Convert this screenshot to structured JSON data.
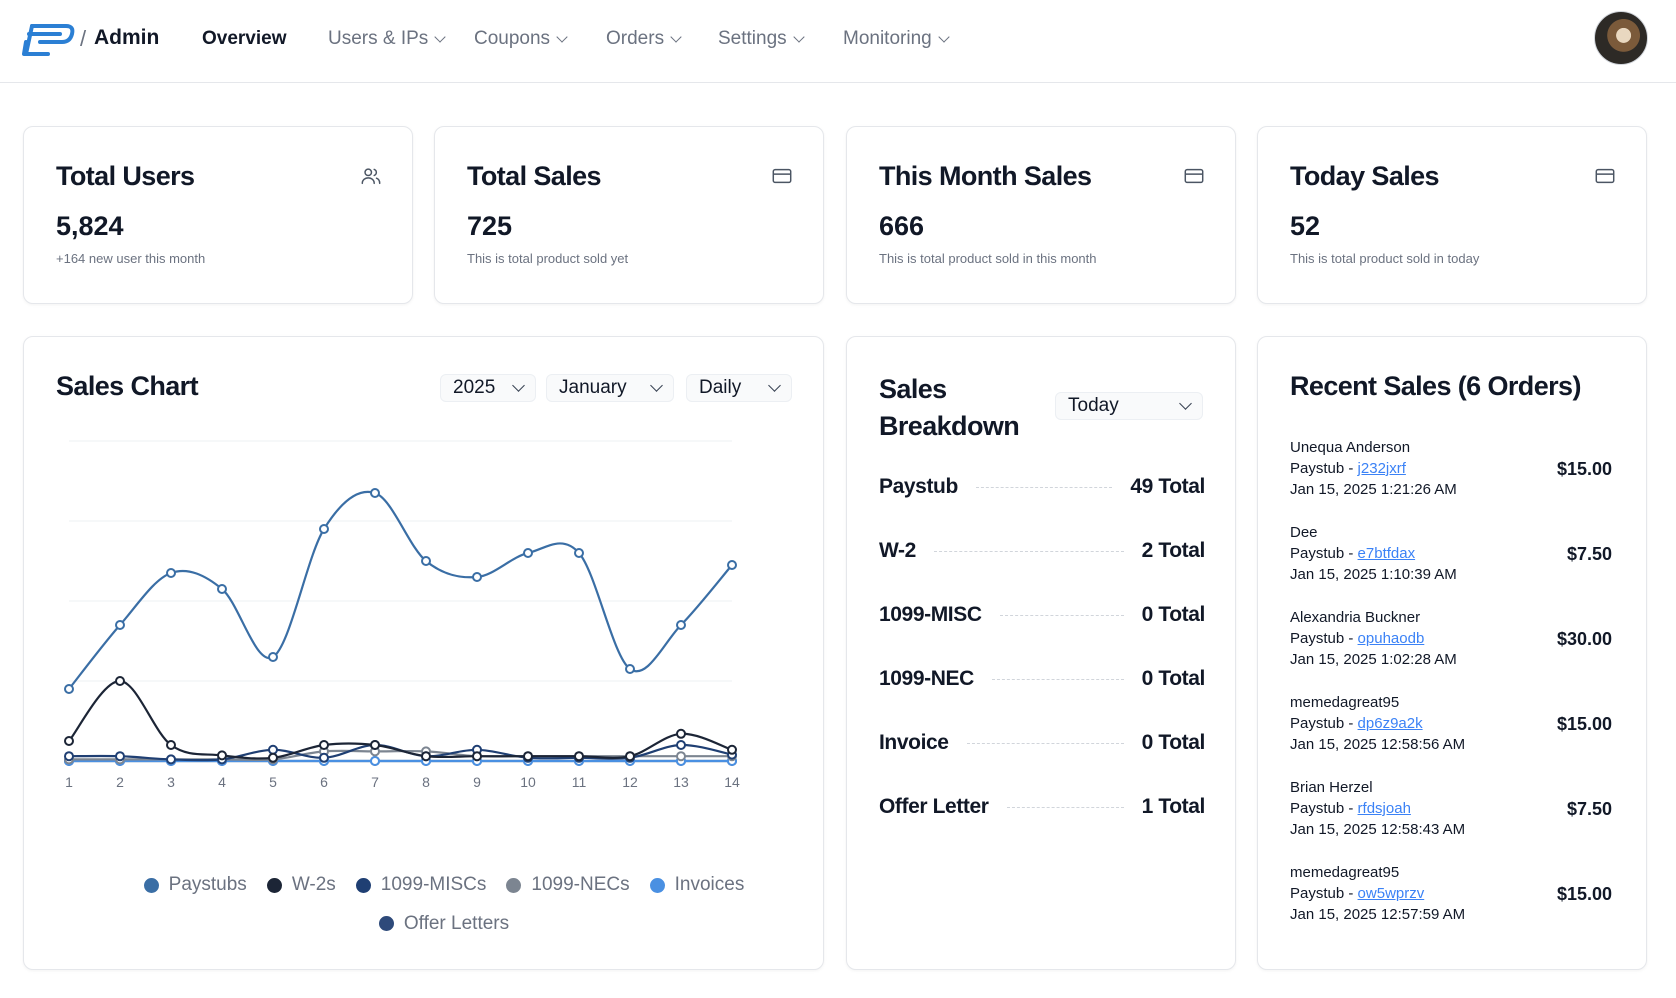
{
  "header": {
    "breadcrumb_sep": "/",
    "breadcrumb_admin": "Admin",
    "nav": [
      {
        "label": "Overview",
        "active": true
      },
      {
        "label": "Users & IPs",
        "active": false
      },
      {
        "label": "Coupons",
        "active": false
      },
      {
        "label": "Orders",
        "active": false
      },
      {
        "label": "Settings",
        "active": false
      },
      {
        "label": "Monitoring",
        "active": false
      }
    ],
    "brand_color": "#2b7fd4"
  },
  "stats": [
    {
      "title": "Total Users",
      "value": "5,824",
      "sub": "+164 new user this month",
      "icon": "users-icon"
    },
    {
      "title": "Total Sales",
      "value": "725",
      "sub": "This is total product sold yet",
      "icon": "credit-card-icon"
    },
    {
      "title": "This Month Sales",
      "value": "666",
      "sub": "This is total product sold in this month",
      "icon": "credit-card-icon"
    },
    {
      "title": "Today Sales",
      "value": "52",
      "sub": "This is total product sold in today",
      "icon": "credit-card-icon"
    }
  ],
  "sales_chart": {
    "title": "Sales Chart",
    "filters": {
      "year": "2025",
      "month": "January",
      "period": "Daily"
    },
    "legend": [
      {
        "name": "Paystubs",
        "color": "#3a6ea5"
      },
      {
        "name": "W-2s",
        "color": "#1c2536"
      },
      {
        "name": "1099-MISCs",
        "color": "#1f3f73"
      },
      {
        "name": "1099-NECs",
        "color": "#7c8591"
      },
      {
        "name": "Invoices",
        "color": "#4a90e2"
      },
      {
        "name": "Offer Letters",
        "color": "#2e4a7a"
      }
    ]
  },
  "chart_data": {
    "type": "line",
    "x": [
      1,
      2,
      3,
      4,
      5,
      6,
      7,
      8,
      9,
      10,
      11,
      12,
      13,
      14
    ],
    "ylim": [
      0,
      40
    ],
    "grid": true,
    "legend_position": "bottom",
    "series": [
      {
        "name": "Paystubs",
        "color": "#3a6ea5",
        "values": [
          9,
          17,
          23.5,
          21.5,
          13,
          29,
          33.5,
          25,
          23,
          26,
          26,
          11.5,
          17,
          24.5
        ]
      },
      {
        "name": "W-2s",
        "color": "#1c2536",
        "values": [
          2.5,
          10,
          2,
          0.7,
          0.4,
          2,
          2,
          0.6,
          0.6,
          0.6,
          0.6,
          0.6,
          3.4,
          1.4
        ]
      },
      {
        "name": "1099-MISCs",
        "color": "#1f3f73",
        "values": [
          0.6,
          0.6,
          0.2,
          0.2,
          1.4,
          0.4,
          2,
          0.6,
          1.4,
          0.4,
          0.4,
          0.4,
          2,
          0.8
        ]
      },
      {
        "name": "1099-NECs",
        "color": "#7c8591",
        "values": [
          0.2,
          0.2,
          0.2,
          0.2,
          0.2,
          1.2,
          1.2,
          1.2,
          0.6,
          0.6,
          0.6,
          0.6,
          0.6,
          0.6
        ]
      },
      {
        "name": "Invoices",
        "color": "#4a90e2",
        "values": [
          0,
          0,
          0,
          0,
          0,
          0,
          0,
          0,
          0,
          0,
          0,
          0,
          0,
          0
        ]
      },
      {
        "name": "Offer Letters",
        "color": "#2e4a7a",
        "values": [
          0,
          0,
          0,
          0,
          0,
          0,
          0,
          0,
          0,
          0,
          0,
          0,
          0,
          0
        ]
      }
    ]
  },
  "breakdown": {
    "title_line1": "Sales",
    "title_line2": "Breakdown",
    "period": "Today",
    "rows": [
      {
        "label": "Paystub",
        "total": "49 Total"
      },
      {
        "label": "W-2",
        "total": "2 Total"
      },
      {
        "label": "1099-MISC",
        "total": "0 Total"
      },
      {
        "label": "1099-NEC",
        "total": "0 Total"
      },
      {
        "label": "Invoice",
        "total": "0 Total"
      },
      {
        "label": "Offer Letter",
        "total": "1 Total"
      }
    ]
  },
  "recent_sales": {
    "title": "Recent Sales (6 Orders)",
    "items": [
      {
        "name": "Unequa Anderson",
        "product": "Paystub -",
        "code": "j232jxrf",
        "date": "Jan 15, 2025 1:21:26 AM",
        "amount": "$15.00"
      },
      {
        "name": "Dee",
        "product": "Paystub -",
        "code": "e7btfdax",
        "date": "Jan 15, 2025 1:10:39 AM",
        "amount": "$7.50"
      },
      {
        "name": "Alexandria Buckner",
        "product": "Paystub -",
        "code": "opuhaodb",
        "date": "Jan 15, 2025 1:02:28 AM",
        "amount": "$30.00"
      },
      {
        "name": "memedagreat95",
        "product": "Paystub -",
        "code": "dp6z9a2k",
        "date": "Jan 15, 2025 12:58:56 AM",
        "amount": "$15.00"
      },
      {
        "name": "Brian Herzel",
        "product": "Paystub -",
        "code": "rfdsjoah",
        "date": "Jan 15, 2025 12:58:43 AM",
        "amount": "$7.50"
      },
      {
        "name": "memedagreat95",
        "product": "Paystub -",
        "code": "ow5wprzv",
        "date": "Jan 15, 2025 12:57:59 AM",
        "amount": "$15.00"
      }
    ]
  }
}
